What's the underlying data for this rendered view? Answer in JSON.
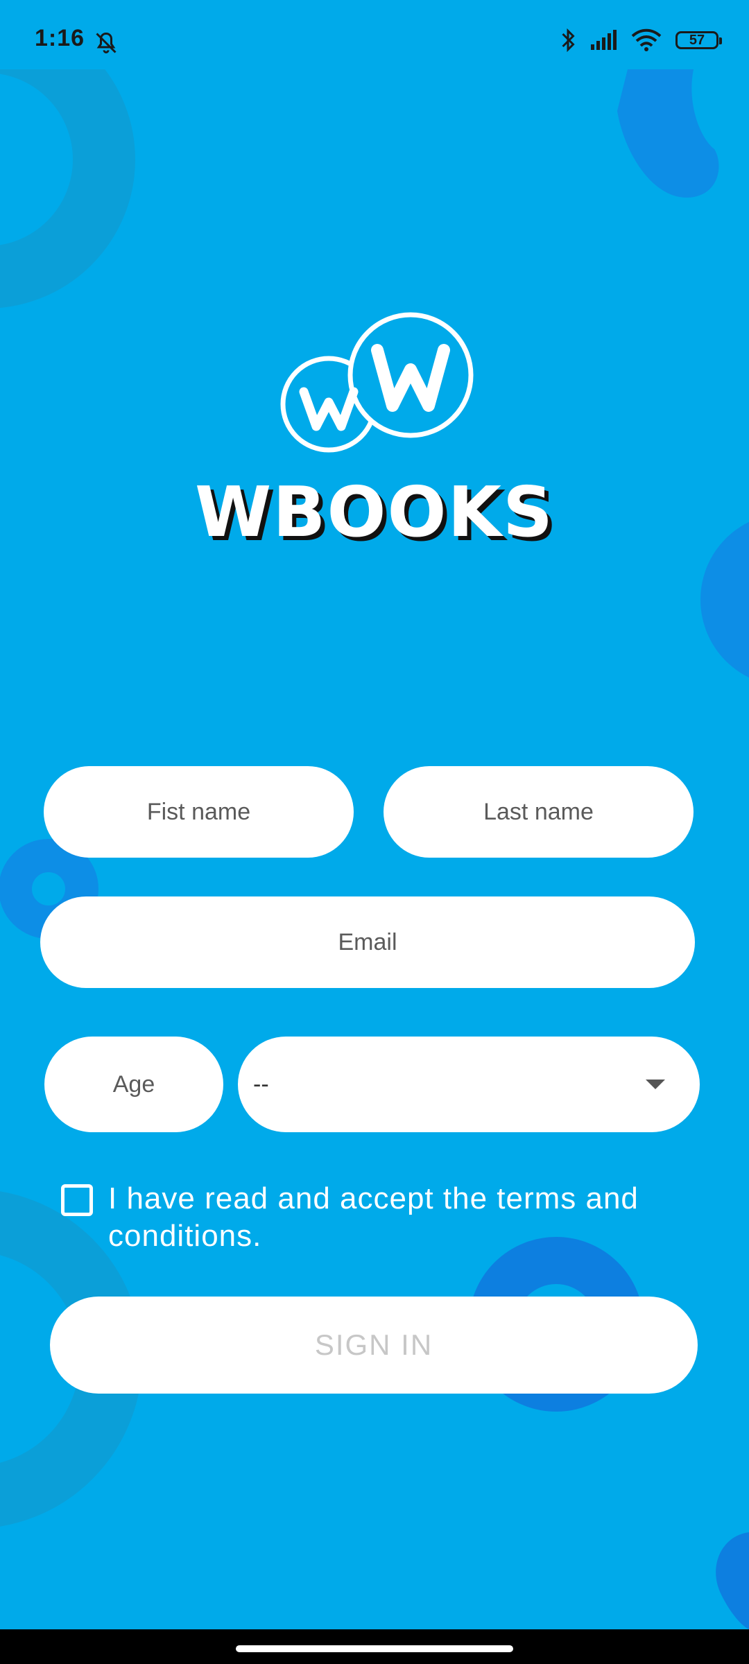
{
  "status": {
    "time": "1:16",
    "battery": "57",
    "icons": [
      "bell-off-icon",
      "bluetooth-icon",
      "signal-icon",
      "wifi-icon",
      "battery-icon"
    ]
  },
  "brand": {
    "logo": "ww-logo-icon",
    "name": "WBOOKS"
  },
  "form": {
    "first_name_placeholder": "Fist name",
    "last_name_placeholder": "Last name",
    "email_placeholder": "Email",
    "age_placeholder": "Age",
    "select_value": "--",
    "terms_text": "I have read and accept the terms and conditions.",
    "signin_label": "SIGN IN"
  },
  "colors": {
    "background": "#00aaea",
    "decor": "#0a8fd9",
    "button_disabled_text": "#c7c7c7"
  }
}
